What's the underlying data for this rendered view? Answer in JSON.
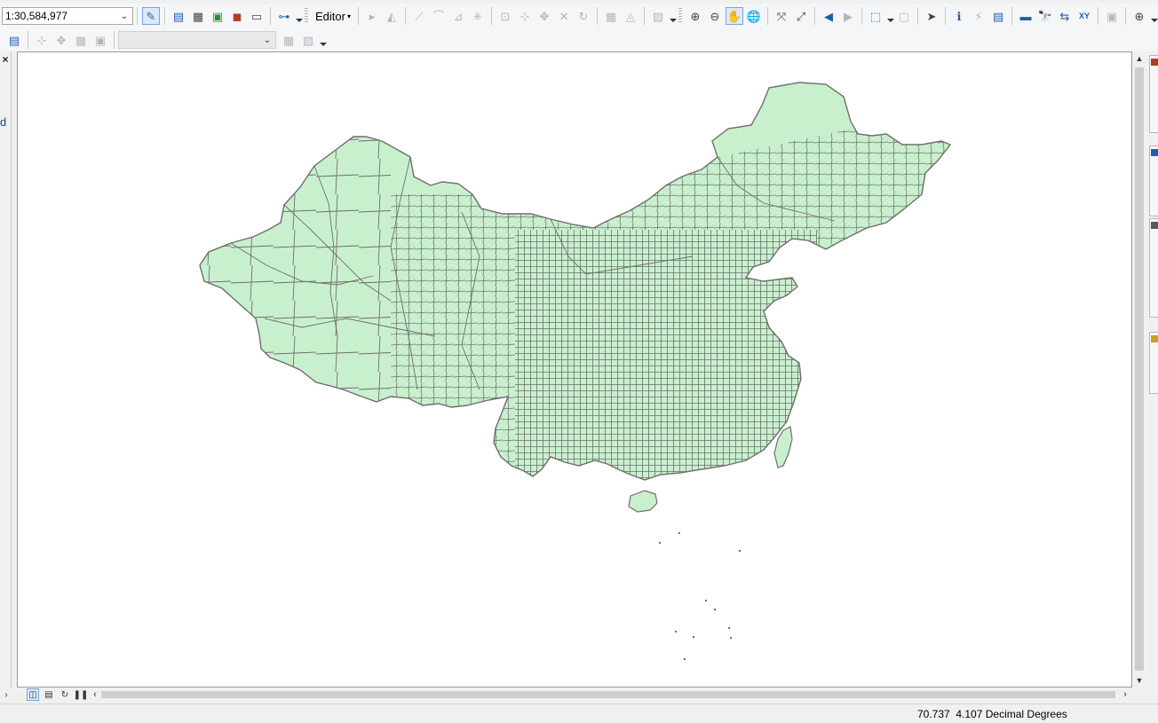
{
  "toolbar": {
    "scale_value": "1:30,584,977",
    "editor_label": "Editor",
    "icons": {
      "full_extent": "◰",
      "editor_caret": "▾",
      "zoom_in": "⊕",
      "zoom_out": "⊖",
      "pan": "✋",
      "globe": "🌐",
      "identify": "ℹ",
      "back": "◀",
      "forward": "▶",
      "select_arrow": "➤",
      "find": "🔭",
      "goto_xy": "XY"
    }
  },
  "left_panel": {
    "close_glyph": "×",
    "fragment": "d"
  },
  "map": {
    "fill_color": "#c9f0cd",
    "stroke_color": "#6e6e6e",
    "background": "#ffffff"
  },
  "status_bar": {
    "x_coord": "70.737",
    "y_coord": "4.107",
    "units": "Decimal Degrees"
  }
}
